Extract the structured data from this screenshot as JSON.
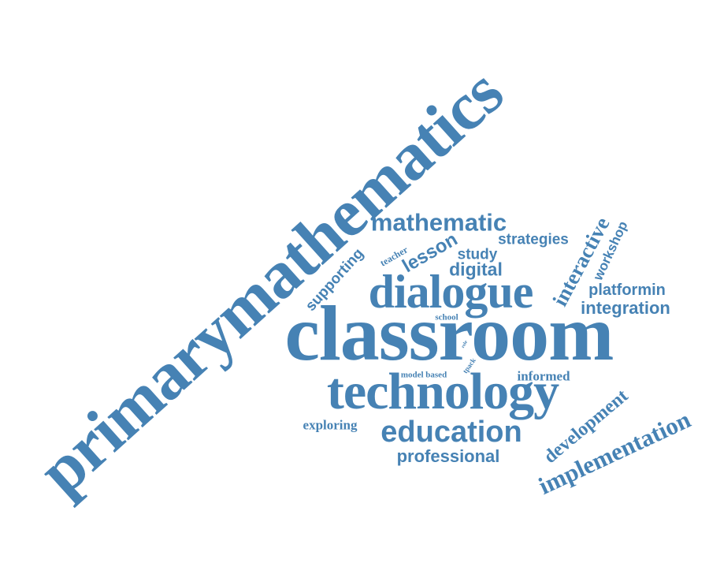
{
  "word_cloud": {
    "color": "#4682b4",
    "words": {
      "primary_mathematics": "primarymathematics",
      "classroom": "classroom",
      "technology": "technology",
      "dialogue": "dialogue",
      "mathematic": "mathematic",
      "education": "education",
      "professional": "professional",
      "implementation": "implementation",
      "development": "development",
      "interactive": "interactive",
      "workshop": "workshop",
      "platformin": "platformin",
      "integration": "integration",
      "strategies": "strategies",
      "study": "study",
      "digital": "digital",
      "lesson": "lesson",
      "teacher": "teacher",
      "supporting": "supporting",
      "school": "school",
      "role": "role",
      "tpack": "tpack",
      "model_based": "model based",
      "informed": "informed",
      "exploring": "exploring"
    }
  }
}
